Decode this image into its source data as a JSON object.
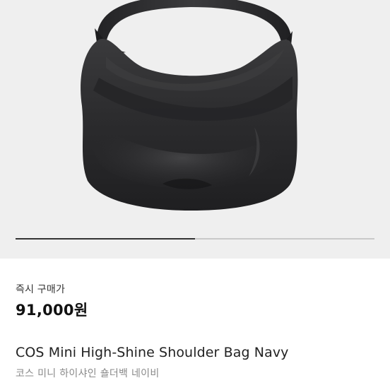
{
  "hero": {
    "image_name": "product-image-bag",
    "carousel_progress": 0.5
  },
  "price": {
    "label": "즉시 구매가",
    "value": "91,000원"
  },
  "product": {
    "title": "COS Mini High-Shine Shoulder Bag Navy",
    "subtitle": "코스 미니 하이샤인 숄더백 네이비"
  }
}
